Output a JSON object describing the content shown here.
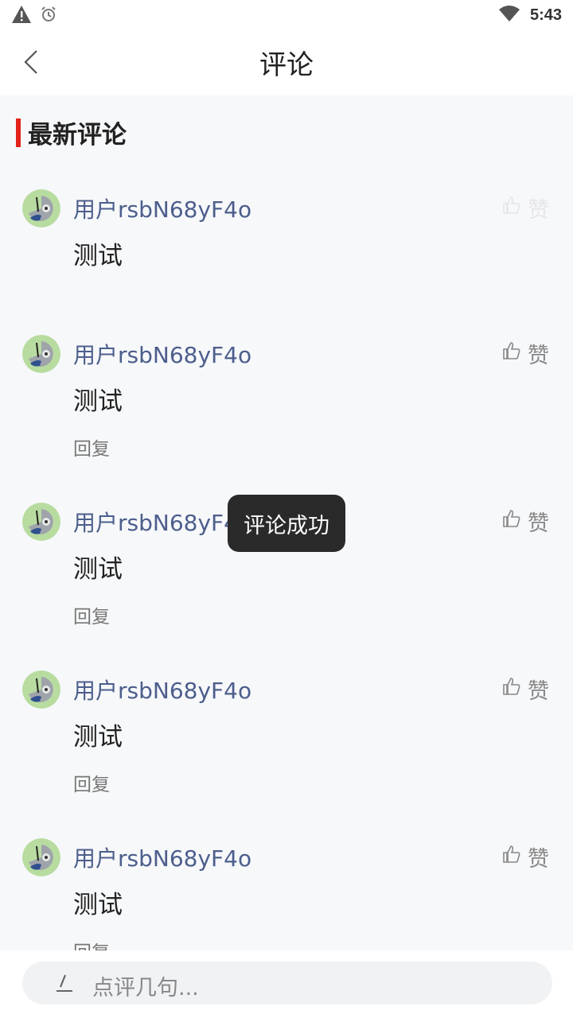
{
  "status_bar": {
    "time": "5:43",
    "icons": [
      "warning-icon",
      "alarm-icon",
      "wifi-icon"
    ]
  },
  "header": {
    "title": "评论",
    "back_icon": "chevron-left-icon"
  },
  "section": {
    "title": "最新评论",
    "accent_color": "#e2231a"
  },
  "comments": [
    {
      "username": "用户rsbN68yF4o",
      "text": "测试",
      "like_label": "赞",
      "reply_label": ""
    },
    {
      "username": "用户rsbN68yF4o",
      "text": "测试",
      "like_label": "赞",
      "reply_label": "回复"
    },
    {
      "username": "用户rsbN68yF4o",
      "text": "测试",
      "like_label": "赞",
      "reply_label": "回复"
    },
    {
      "username": "用户rsbN68yF4o",
      "text": "测试",
      "like_label": "赞",
      "reply_label": "回复"
    },
    {
      "username": "用户rsbN68yF4o",
      "text": "测试",
      "like_label": "赞",
      "reply_label": "回复"
    }
  ],
  "toast": {
    "text": "评论成功"
  },
  "comment_input": {
    "placeholder": "点评几句..."
  },
  "colors": {
    "username": "#4c5e8c",
    "background": "#f7f8fa"
  }
}
